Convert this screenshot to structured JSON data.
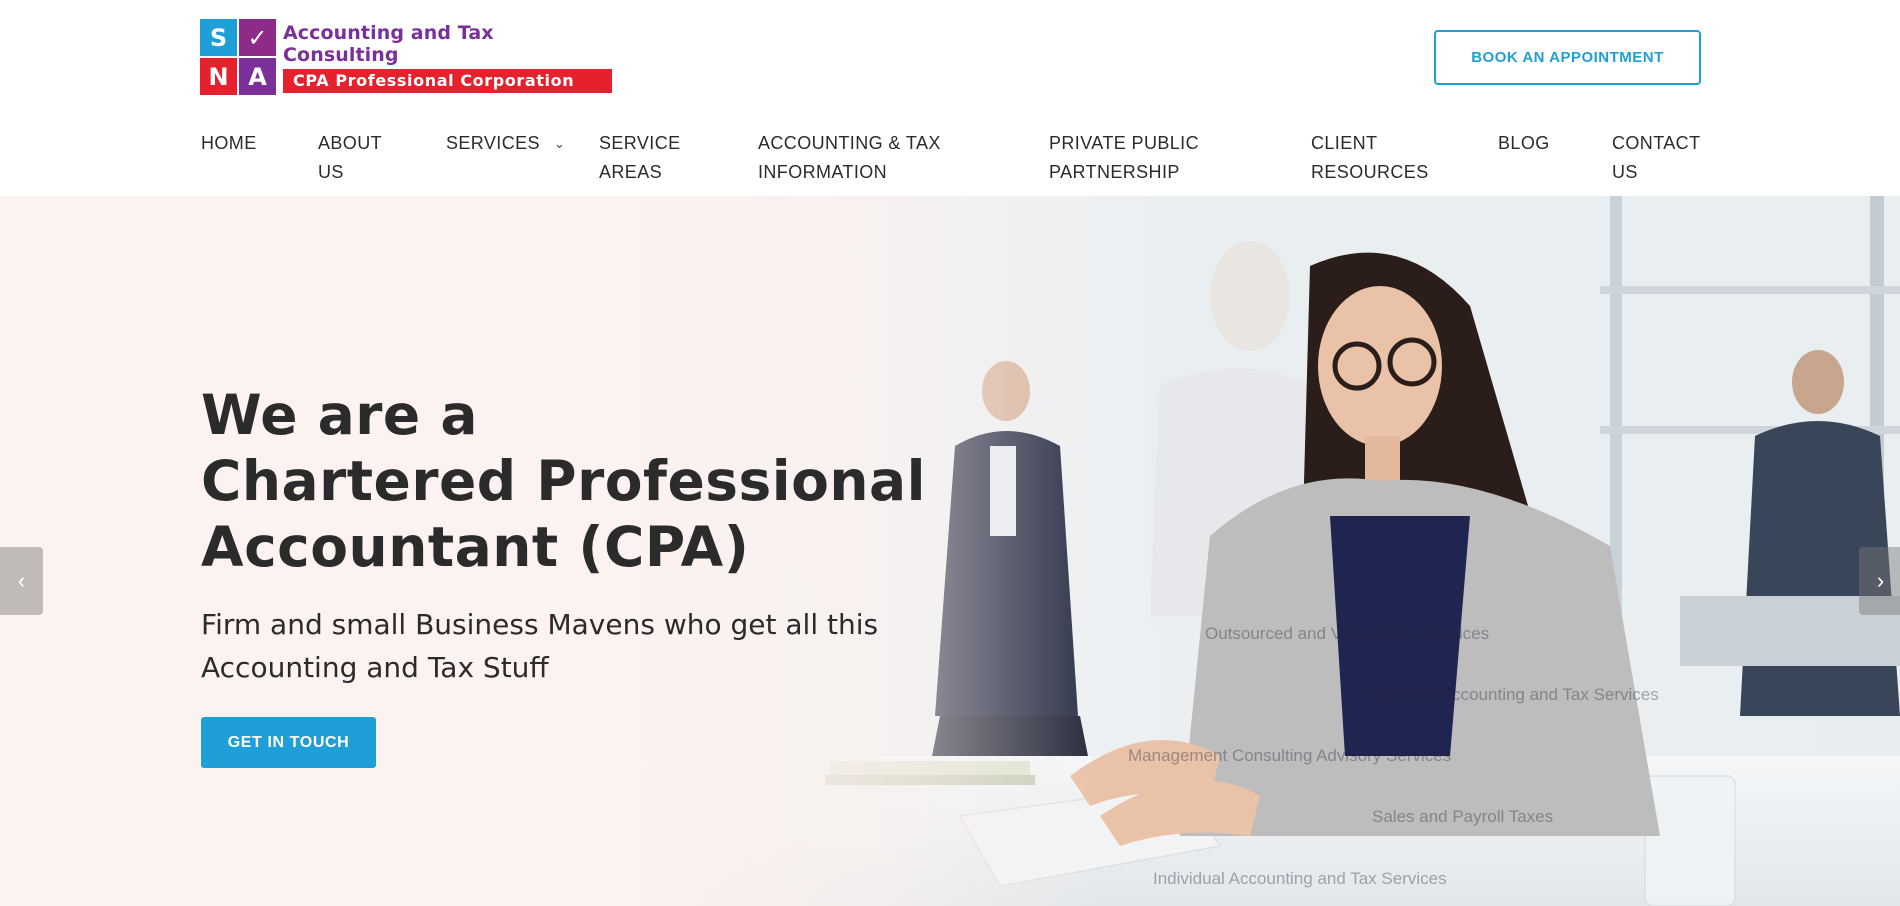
{
  "logo": {
    "tiles": [
      "S",
      "✓",
      "N",
      "A"
    ],
    "line1": "Accounting and Tax Consulting",
    "line2": "CPA Professional Corporation"
  },
  "header": {
    "book_label": "BOOK AN APPOINTMENT"
  },
  "nav": {
    "home": "HOME",
    "about": "ABOUT\nUS",
    "services": "SERVICES",
    "service_areas": "SERVICE\nAREAS",
    "acct_info": "ACCOUNTING & TAX\nINFORMATION",
    "ppp": "PRIVATE PUBLIC\nPARTNERSHIP",
    "client_resources": "CLIENT\nRESOURCES",
    "blog": "BLOG",
    "contact": "CONTACT\nUS"
  },
  "hero": {
    "title_l1": "We are a",
    "title_l2": "Chartered Professional",
    "title_l3": "Accountant (CPA)",
    "sub_l1": "Firm and small Business Mavens who get all this",
    "sub_l2": "Accounting and Tax Stuff",
    "cta_label": "GET IN TOUCH",
    "overlay": [
      "Outsourced and Virtual CFO Services",
      "Business Accounting and Tax Services",
      "Management Consulting Advisory Services",
      "Sales and Payroll Taxes",
      "Individual Accounting and Tax Services"
    ]
  },
  "colors": {
    "brand_blue": "#1e9fd8",
    "brand_purple": "#7a2f99",
    "brand_red": "#e6202c",
    "hero_bg": "#fcf2ef"
  },
  "icons": {
    "prev": "chevron-left-icon",
    "next": "chevron-right-icon",
    "services_caret": "chevron-down-icon"
  }
}
